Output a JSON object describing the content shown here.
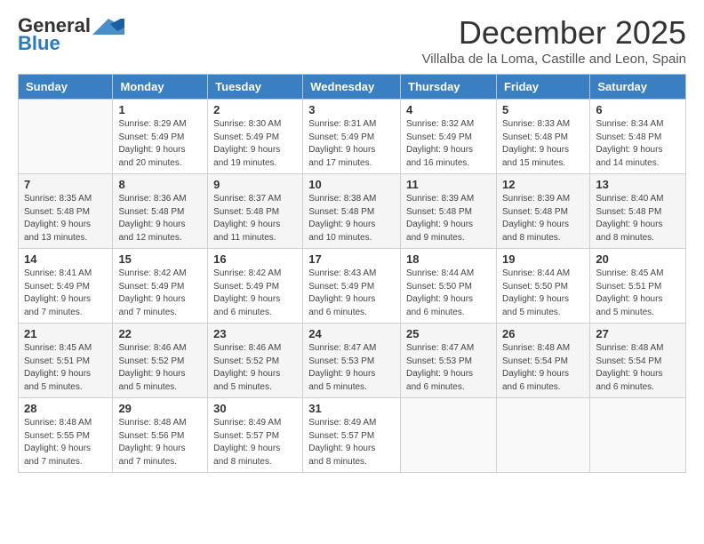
{
  "logo": {
    "line1": "General",
    "line2": "Blue"
  },
  "title": "December 2025",
  "location": "Villalba de la Loma, Castille and Leon, Spain",
  "days_of_week": [
    "Sunday",
    "Monday",
    "Tuesday",
    "Wednesday",
    "Thursday",
    "Friday",
    "Saturday"
  ],
  "weeks": [
    [
      {
        "day": "",
        "info": ""
      },
      {
        "day": "1",
        "info": "Sunrise: 8:29 AM\nSunset: 5:49 PM\nDaylight: 9 hours\nand 20 minutes."
      },
      {
        "day": "2",
        "info": "Sunrise: 8:30 AM\nSunset: 5:49 PM\nDaylight: 9 hours\nand 19 minutes."
      },
      {
        "day": "3",
        "info": "Sunrise: 8:31 AM\nSunset: 5:49 PM\nDaylight: 9 hours\nand 17 minutes."
      },
      {
        "day": "4",
        "info": "Sunrise: 8:32 AM\nSunset: 5:49 PM\nDaylight: 9 hours\nand 16 minutes."
      },
      {
        "day": "5",
        "info": "Sunrise: 8:33 AM\nSunset: 5:48 PM\nDaylight: 9 hours\nand 15 minutes."
      },
      {
        "day": "6",
        "info": "Sunrise: 8:34 AM\nSunset: 5:48 PM\nDaylight: 9 hours\nand 14 minutes."
      }
    ],
    [
      {
        "day": "7",
        "info": "Sunrise: 8:35 AM\nSunset: 5:48 PM\nDaylight: 9 hours\nand 13 minutes."
      },
      {
        "day": "8",
        "info": "Sunrise: 8:36 AM\nSunset: 5:48 PM\nDaylight: 9 hours\nand 12 minutes."
      },
      {
        "day": "9",
        "info": "Sunrise: 8:37 AM\nSunset: 5:48 PM\nDaylight: 9 hours\nand 11 minutes."
      },
      {
        "day": "10",
        "info": "Sunrise: 8:38 AM\nSunset: 5:48 PM\nDaylight: 9 hours\nand 10 minutes."
      },
      {
        "day": "11",
        "info": "Sunrise: 8:39 AM\nSunset: 5:48 PM\nDaylight: 9 hours\nand 9 minutes."
      },
      {
        "day": "12",
        "info": "Sunrise: 8:39 AM\nSunset: 5:48 PM\nDaylight: 9 hours\nand 8 minutes."
      },
      {
        "day": "13",
        "info": "Sunrise: 8:40 AM\nSunset: 5:48 PM\nDaylight: 9 hours\nand 8 minutes."
      }
    ],
    [
      {
        "day": "14",
        "info": "Sunrise: 8:41 AM\nSunset: 5:49 PM\nDaylight: 9 hours\nand 7 minutes."
      },
      {
        "day": "15",
        "info": "Sunrise: 8:42 AM\nSunset: 5:49 PM\nDaylight: 9 hours\nand 7 minutes."
      },
      {
        "day": "16",
        "info": "Sunrise: 8:42 AM\nSunset: 5:49 PM\nDaylight: 9 hours\nand 6 minutes."
      },
      {
        "day": "17",
        "info": "Sunrise: 8:43 AM\nSunset: 5:49 PM\nDaylight: 9 hours\nand 6 minutes."
      },
      {
        "day": "18",
        "info": "Sunrise: 8:44 AM\nSunset: 5:50 PM\nDaylight: 9 hours\nand 6 minutes."
      },
      {
        "day": "19",
        "info": "Sunrise: 8:44 AM\nSunset: 5:50 PM\nDaylight: 9 hours\nand 5 minutes."
      },
      {
        "day": "20",
        "info": "Sunrise: 8:45 AM\nSunset: 5:51 PM\nDaylight: 9 hours\nand 5 minutes."
      }
    ],
    [
      {
        "day": "21",
        "info": "Sunrise: 8:45 AM\nSunset: 5:51 PM\nDaylight: 9 hours\nand 5 minutes."
      },
      {
        "day": "22",
        "info": "Sunrise: 8:46 AM\nSunset: 5:52 PM\nDaylight: 9 hours\nand 5 minutes."
      },
      {
        "day": "23",
        "info": "Sunrise: 8:46 AM\nSunset: 5:52 PM\nDaylight: 9 hours\nand 5 minutes."
      },
      {
        "day": "24",
        "info": "Sunrise: 8:47 AM\nSunset: 5:53 PM\nDaylight: 9 hours\nand 5 minutes."
      },
      {
        "day": "25",
        "info": "Sunrise: 8:47 AM\nSunset: 5:53 PM\nDaylight: 9 hours\nand 6 minutes."
      },
      {
        "day": "26",
        "info": "Sunrise: 8:48 AM\nSunset: 5:54 PM\nDaylight: 9 hours\nand 6 minutes."
      },
      {
        "day": "27",
        "info": "Sunrise: 8:48 AM\nSunset: 5:54 PM\nDaylight: 9 hours\nand 6 minutes."
      }
    ],
    [
      {
        "day": "28",
        "info": "Sunrise: 8:48 AM\nSunset: 5:55 PM\nDaylight: 9 hours\nand 7 minutes."
      },
      {
        "day": "29",
        "info": "Sunrise: 8:48 AM\nSunset: 5:56 PM\nDaylight: 9 hours\nand 7 minutes."
      },
      {
        "day": "30",
        "info": "Sunrise: 8:49 AM\nSunset: 5:57 PM\nDaylight: 9 hours\nand 8 minutes."
      },
      {
        "day": "31",
        "info": "Sunrise: 8:49 AM\nSunset: 5:57 PM\nDaylight: 9 hours\nand 8 minutes."
      },
      {
        "day": "",
        "info": ""
      },
      {
        "day": "",
        "info": ""
      },
      {
        "day": "",
        "info": ""
      }
    ]
  ]
}
